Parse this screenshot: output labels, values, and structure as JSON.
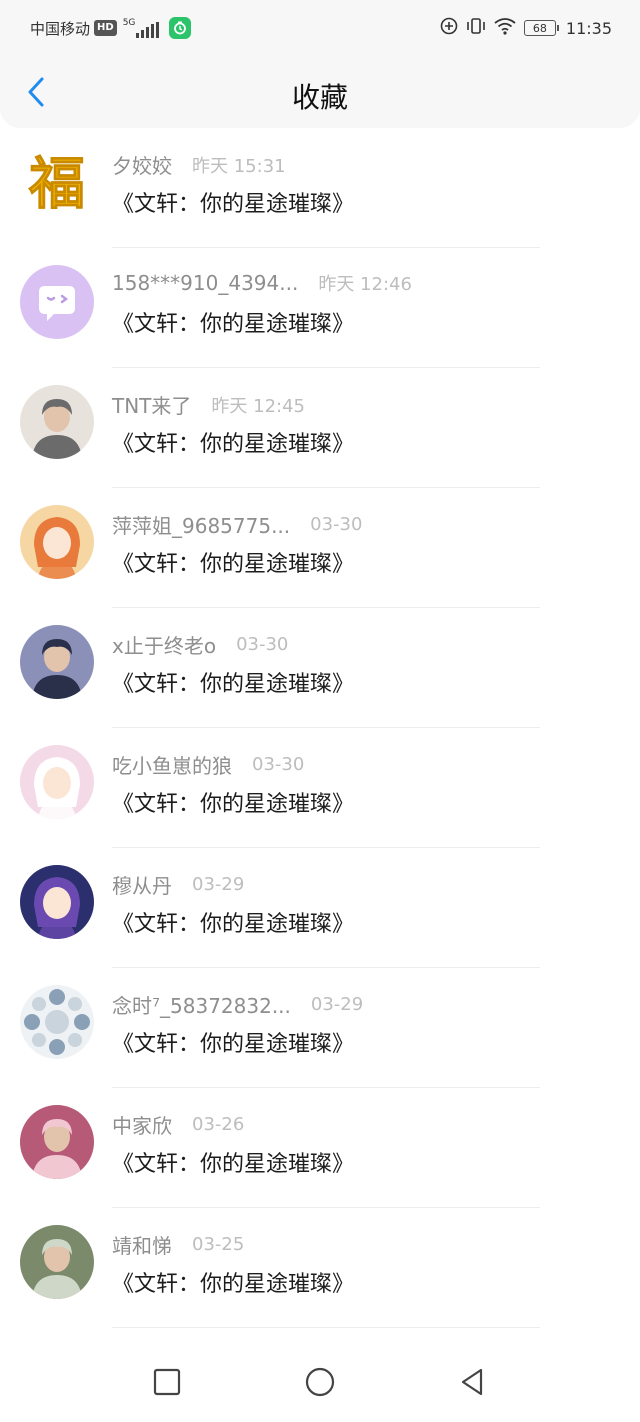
{
  "status_bar": {
    "carrier": "中国移动",
    "hd": "HD",
    "network": "5G",
    "battery": "68",
    "time": "11:35"
  },
  "header": {
    "title": "收藏"
  },
  "items": [
    {
      "name": "夕姣姣",
      "time": "昨天 15:31",
      "content": "《文轩：你的星途璀璨》",
      "avatar": "fu-avatar"
    },
    {
      "name": "158***910_4394...",
      "time": "昨天 12:46",
      "content": "《文轩：你的星途璀璨》",
      "avatar": "default-avatar"
    },
    {
      "name": "TNT来了",
      "time": "昨天 12:45",
      "content": "《文轩：你的星途璀璨》",
      "avatar": "photo-avatar"
    },
    {
      "name": "萍萍姐_9685775...",
      "time": "03-30",
      "content": "《文轩：你的星途璀璨》",
      "avatar": "anime-avatar"
    },
    {
      "name": "x止于终老o",
      "time": "03-30",
      "content": "《文轩：你的星途璀璨》",
      "avatar": "photo-avatar"
    },
    {
      "name": "吃小鱼崽的狼",
      "time": "03-30",
      "content": "《文轩：你的星途璀璨》",
      "avatar": "anime-avatar"
    },
    {
      "name": "穆从丹",
      "time": "03-29",
      "content": "《文轩：你的星途璀璨》",
      "avatar": "anime-avatar"
    },
    {
      "name": "念时⁷_58372832...",
      "time": "03-29",
      "content": "《文轩：你的星途璀璨》",
      "avatar": "collage-avatar"
    },
    {
      "name": "中家欣",
      "time": "03-26",
      "content": "《文轩：你的星途璀璨》",
      "avatar": "photo-avatar"
    },
    {
      "name": "靖和悌",
      "time": "03-25",
      "content": "《文轩：你的星途璀璨》",
      "avatar": "photo-avatar"
    }
  ],
  "avatar_colors": [
    "#f3b400",
    "#d9c2f3",
    "#6b6b6b",
    "#f6d7a4",
    "#2a2f4a",
    "#f4d9e6",
    "#2b2f6e",
    "#c9d4dc",
    "#f1c8d2",
    "#cfd8c8"
  ],
  "avatar_accents": [
    "#ffe066",
    "#ffffff",
    "#e8e2dc",
    "#e87a3b",
    "#8b90b8",
    "#ffffff",
    "#6a4ab0",
    "#8aa0b6",
    "#b65a78",
    "#7a8a6a"
  ],
  "colors": {
    "accent": "#1f8df0",
    "name_gray": "#8e8e8e",
    "time_gray": "#bdbdbd"
  },
  "icons": {
    "back": "chevron-left-icon",
    "nav_square": "square-icon",
    "nav_home": "circle-icon",
    "nav_back": "triangle-back-icon"
  }
}
